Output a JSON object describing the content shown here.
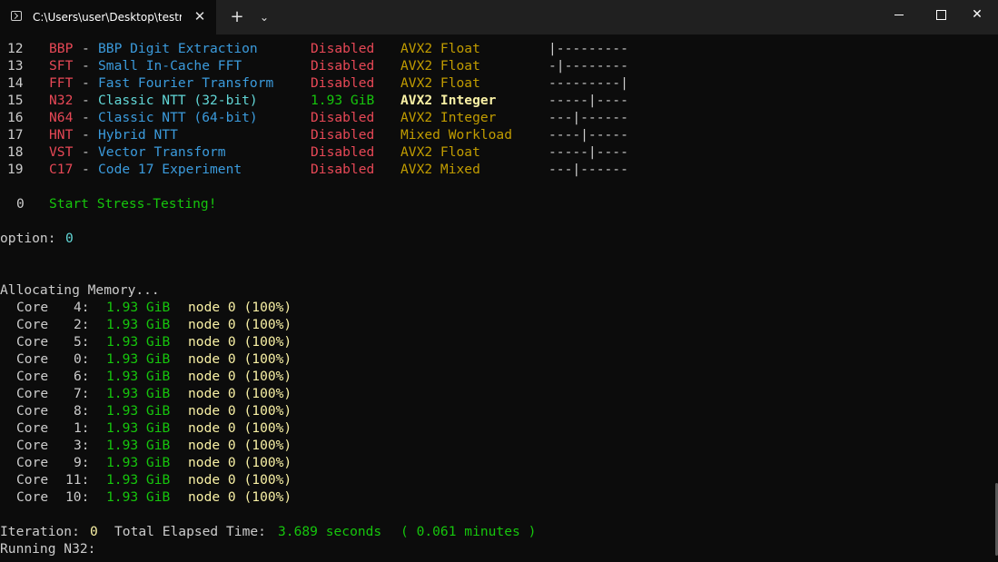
{
  "window": {
    "tab_title": "C:\\Users\\user\\Desktop\\testme",
    "new_tab_glyph": "+",
    "dropdown_glyph": "⌄",
    "close_glyph": "✕",
    "win_close_glyph": "✕"
  },
  "tests": [
    {
      "num": "12",
      "code": "BBP",
      "name": "BBP Digit Extraction",
      "status": "Disabled",
      "kind": "AVX2 Float",
      "meter": "|---------"
    },
    {
      "num": "13",
      "code": "SFT",
      "name": "Small In-Cache FFT",
      "status": "Disabled",
      "kind": "AVX2 Float",
      "meter": "-|--------"
    },
    {
      "num": "14",
      "code": "FFT",
      "name": "Fast Fourier Transform",
      "status": "Disabled",
      "kind": "AVX2 Float",
      "meter": "---------|"
    },
    {
      "num": "15",
      "code": "N32",
      "name": "Classic NTT (32-bit)",
      "status": "1.93 GiB",
      "kind": "AVX2 Integer",
      "meter": "-----|----"
    },
    {
      "num": "16",
      "code": "N64",
      "name": "Classic NTT (64-bit)",
      "status": "Disabled",
      "kind": "AVX2 Integer",
      "meter": "---|------"
    },
    {
      "num": "17",
      "code": "HNT",
      "name": "Hybrid NTT",
      "status": "Disabled",
      "kind": "Mixed Workload",
      "meter": "----|-----"
    },
    {
      "num": "18",
      "code": "VST",
      "name": "Vector Transform",
      "status": "Disabled",
      "kind": "AVX2 Float",
      "meter": "-----|----"
    },
    {
      "num": "19",
      "code": "C17",
      "name": "Code 17 Experiment",
      "status": "Disabled",
      "kind": "AVX2 Mixed",
      "meter": "---|------"
    }
  ],
  "dash": "-",
  "start": {
    "num": "0",
    "label": "Start Stress-Testing!"
  },
  "option": {
    "label": "option:",
    "value": "0"
  },
  "allocating": "Allocating Memory...",
  "cores": [
    {
      "label": "Core",
      "id": "4:",
      "size": "1.93 GiB",
      "node": "node 0 (100%)"
    },
    {
      "label": "Core",
      "id": "2:",
      "size": "1.93 GiB",
      "node": "node 0 (100%)"
    },
    {
      "label": "Core",
      "id": "5:",
      "size": "1.93 GiB",
      "node": "node 0 (100%)"
    },
    {
      "label": "Core",
      "id": "0:",
      "size": "1.93 GiB",
      "node": "node 0 (100%)"
    },
    {
      "label": "Core",
      "id": "6:",
      "size": "1.93 GiB",
      "node": "node 0 (100%)"
    },
    {
      "label": "Core",
      "id": "7:",
      "size": "1.93 GiB",
      "node": "node 0 (100%)"
    },
    {
      "label": "Core",
      "id": "8:",
      "size": "1.93 GiB",
      "node": "node 0 (100%)"
    },
    {
      "label": "Core",
      "id": "1:",
      "size": "1.93 GiB",
      "node": "node 0 (100%)"
    },
    {
      "label": "Core",
      "id": "3:",
      "size": "1.93 GiB",
      "node": "node 0 (100%)"
    },
    {
      "label": "Core",
      "id": "9:",
      "size": "1.93 GiB",
      "node": "node 0 (100%)"
    },
    {
      "label": "Core",
      "id": "11:",
      "size": "1.93 GiB",
      "node": "node 0 (100%)"
    },
    {
      "label": "Core",
      "id": "10:",
      "size": "1.93 GiB",
      "node": "node 0 (100%)"
    }
  ],
  "iteration": {
    "label": "Iteration:",
    "value": "0",
    "elapsed_label": "Total Elapsed Time:",
    "elapsed_value": "3.689 seconds",
    "minutes": "( 0.061 minutes )"
  },
  "running": "Running N32:",
  "colors": {
    "background": "#0c0c0c",
    "titlebar": "#202020",
    "red": "#e74856",
    "blue": "#3b9bdc",
    "cyan": "#61d6d6",
    "green": "#16c60c",
    "yellow": "#c19c00",
    "bright_yellow": "#f9f1a5"
  }
}
